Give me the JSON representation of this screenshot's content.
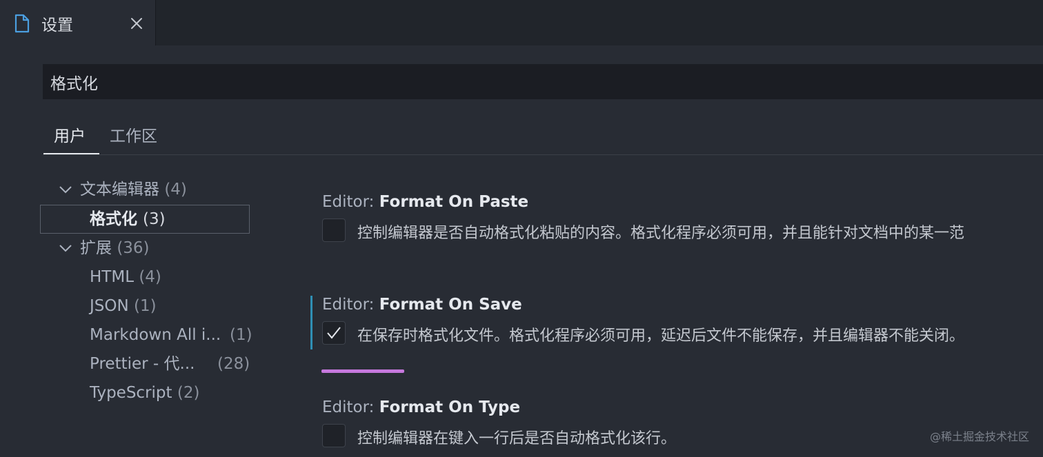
{
  "tab": {
    "title": "设置",
    "file_icon": "file-icon",
    "close_icon": "close-icon"
  },
  "search": {
    "value": "格式化"
  },
  "scope_tabs": [
    {
      "label": "用户",
      "active": true
    },
    {
      "label": "工作区",
      "active": false
    }
  ],
  "toc": {
    "items": [
      {
        "label": "文本编辑器",
        "count": "(4)",
        "expandable": true
      },
      {
        "label": "格式化",
        "count": "(3)",
        "selected": true
      },
      {
        "label": "扩展",
        "count": "(36)",
        "expandable": true
      },
      {
        "label": "HTML",
        "count": "(4)"
      },
      {
        "label": "JSON",
        "count": "(1)"
      },
      {
        "label": "Markdown All i...",
        "count": "(1)"
      },
      {
        "label": "Prettier - 代...",
        "count": "(28)"
      },
      {
        "label": "TypeScript",
        "count": "(2)"
      }
    ]
  },
  "settings": [
    {
      "prefix": "Editor: ",
      "name": "Format On Paste",
      "checked": false,
      "description": "控制编辑器是否自动格式化粘贴的内容。格式化程序必须可用，并且能针对文档中的某一范"
    },
    {
      "prefix": "Editor: ",
      "name": "Format On Save",
      "checked": true,
      "focused": true,
      "description": "在保存时格式化文件。格式化程序必须可用，延迟后文件不能保存，并且编辑器不能关闭。"
    },
    {
      "prefix": "Editor: ",
      "name": "Format On Type",
      "checked": false,
      "description": "控制编辑器在键入一行后是否自动格式化该行。"
    }
  ],
  "watermark": "@稀土掘金技术社区",
  "colors": {
    "background": "#282c34",
    "focus_bar": "#2f8fb4",
    "progress": "#c678dd"
  }
}
